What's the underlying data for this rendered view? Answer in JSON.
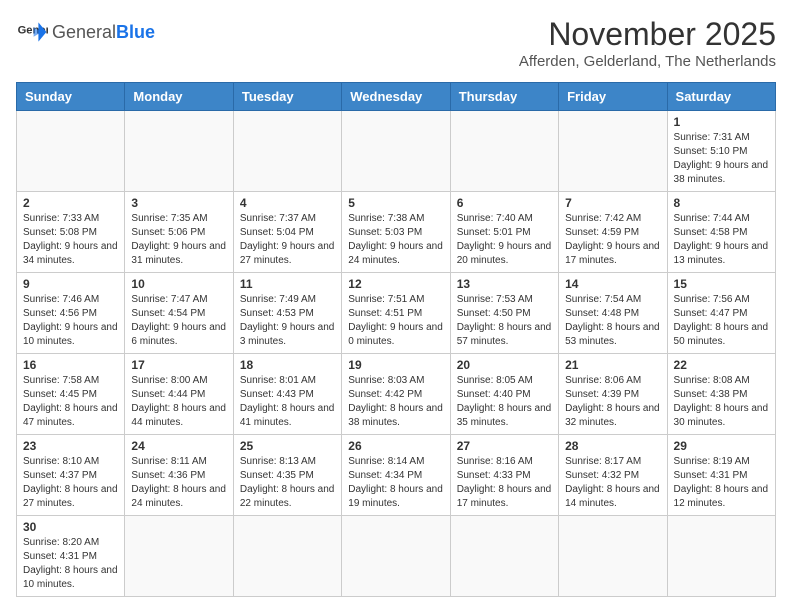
{
  "header": {
    "logo_general": "General",
    "logo_blue": "Blue",
    "month_title": "November 2025",
    "location": "Afferden, Gelderland, The Netherlands"
  },
  "weekdays": [
    "Sunday",
    "Monday",
    "Tuesday",
    "Wednesday",
    "Thursday",
    "Friday",
    "Saturday"
  ],
  "weeks": [
    [
      {
        "day": "",
        "info": ""
      },
      {
        "day": "",
        "info": ""
      },
      {
        "day": "",
        "info": ""
      },
      {
        "day": "",
        "info": ""
      },
      {
        "day": "",
        "info": ""
      },
      {
        "day": "",
        "info": ""
      },
      {
        "day": "1",
        "info": "Sunrise: 7:31 AM\nSunset: 5:10 PM\nDaylight: 9 hours and 38 minutes."
      }
    ],
    [
      {
        "day": "2",
        "info": "Sunrise: 7:33 AM\nSunset: 5:08 PM\nDaylight: 9 hours and 34 minutes."
      },
      {
        "day": "3",
        "info": "Sunrise: 7:35 AM\nSunset: 5:06 PM\nDaylight: 9 hours and 31 minutes."
      },
      {
        "day": "4",
        "info": "Sunrise: 7:37 AM\nSunset: 5:04 PM\nDaylight: 9 hours and 27 minutes."
      },
      {
        "day": "5",
        "info": "Sunrise: 7:38 AM\nSunset: 5:03 PM\nDaylight: 9 hours and 24 minutes."
      },
      {
        "day": "6",
        "info": "Sunrise: 7:40 AM\nSunset: 5:01 PM\nDaylight: 9 hours and 20 minutes."
      },
      {
        "day": "7",
        "info": "Sunrise: 7:42 AM\nSunset: 4:59 PM\nDaylight: 9 hours and 17 minutes."
      },
      {
        "day": "8",
        "info": "Sunrise: 7:44 AM\nSunset: 4:58 PM\nDaylight: 9 hours and 13 minutes."
      }
    ],
    [
      {
        "day": "9",
        "info": "Sunrise: 7:46 AM\nSunset: 4:56 PM\nDaylight: 9 hours and 10 minutes."
      },
      {
        "day": "10",
        "info": "Sunrise: 7:47 AM\nSunset: 4:54 PM\nDaylight: 9 hours and 6 minutes."
      },
      {
        "day": "11",
        "info": "Sunrise: 7:49 AM\nSunset: 4:53 PM\nDaylight: 9 hours and 3 minutes."
      },
      {
        "day": "12",
        "info": "Sunrise: 7:51 AM\nSunset: 4:51 PM\nDaylight: 9 hours and 0 minutes."
      },
      {
        "day": "13",
        "info": "Sunrise: 7:53 AM\nSunset: 4:50 PM\nDaylight: 8 hours and 57 minutes."
      },
      {
        "day": "14",
        "info": "Sunrise: 7:54 AM\nSunset: 4:48 PM\nDaylight: 8 hours and 53 minutes."
      },
      {
        "day": "15",
        "info": "Sunrise: 7:56 AM\nSunset: 4:47 PM\nDaylight: 8 hours and 50 minutes."
      }
    ],
    [
      {
        "day": "16",
        "info": "Sunrise: 7:58 AM\nSunset: 4:45 PM\nDaylight: 8 hours and 47 minutes."
      },
      {
        "day": "17",
        "info": "Sunrise: 8:00 AM\nSunset: 4:44 PM\nDaylight: 8 hours and 44 minutes."
      },
      {
        "day": "18",
        "info": "Sunrise: 8:01 AM\nSunset: 4:43 PM\nDaylight: 8 hours and 41 minutes."
      },
      {
        "day": "19",
        "info": "Sunrise: 8:03 AM\nSunset: 4:42 PM\nDaylight: 8 hours and 38 minutes."
      },
      {
        "day": "20",
        "info": "Sunrise: 8:05 AM\nSunset: 4:40 PM\nDaylight: 8 hours and 35 minutes."
      },
      {
        "day": "21",
        "info": "Sunrise: 8:06 AM\nSunset: 4:39 PM\nDaylight: 8 hours and 32 minutes."
      },
      {
        "day": "22",
        "info": "Sunrise: 8:08 AM\nSunset: 4:38 PM\nDaylight: 8 hours and 30 minutes."
      }
    ],
    [
      {
        "day": "23",
        "info": "Sunrise: 8:10 AM\nSunset: 4:37 PM\nDaylight: 8 hours and 27 minutes."
      },
      {
        "day": "24",
        "info": "Sunrise: 8:11 AM\nSunset: 4:36 PM\nDaylight: 8 hours and 24 minutes."
      },
      {
        "day": "25",
        "info": "Sunrise: 8:13 AM\nSunset: 4:35 PM\nDaylight: 8 hours and 22 minutes."
      },
      {
        "day": "26",
        "info": "Sunrise: 8:14 AM\nSunset: 4:34 PM\nDaylight: 8 hours and 19 minutes."
      },
      {
        "day": "27",
        "info": "Sunrise: 8:16 AM\nSunset: 4:33 PM\nDaylight: 8 hours and 17 minutes."
      },
      {
        "day": "28",
        "info": "Sunrise: 8:17 AM\nSunset: 4:32 PM\nDaylight: 8 hours and 14 minutes."
      },
      {
        "day": "29",
        "info": "Sunrise: 8:19 AM\nSunset: 4:31 PM\nDaylight: 8 hours and 12 minutes."
      }
    ],
    [
      {
        "day": "30",
        "info": "Sunrise: 8:20 AM\nSunset: 4:31 PM\nDaylight: 8 hours and 10 minutes."
      },
      {
        "day": "",
        "info": ""
      },
      {
        "day": "",
        "info": ""
      },
      {
        "day": "",
        "info": ""
      },
      {
        "day": "",
        "info": ""
      },
      {
        "day": "",
        "info": ""
      },
      {
        "day": "",
        "info": ""
      }
    ]
  ]
}
